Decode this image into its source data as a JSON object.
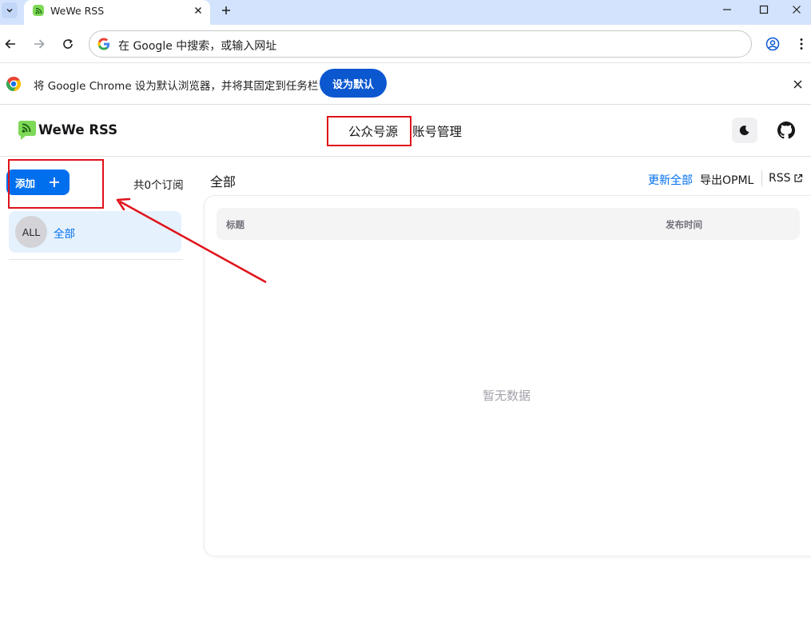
{
  "browser": {
    "tab_title": "WeWe RSS",
    "omnibox_placeholder": "在 Google 中搜索，或输入网址",
    "infobar_text": "将 Google Chrome 设为默认浏览器，并将其固定到任务栏",
    "infobar_button": "设为默认"
  },
  "app": {
    "brand": "WeWe RSS",
    "nav": {
      "active": "公众号源",
      "second": "账号管理"
    },
    "sidebar": {
      "add_label": "添加",
      "subscription_count": "共0个订阅",
      "feeds": [
        {
          "avatar": "ALL",
          "label": "全部"
        }
      ]
    },
    "main": {
      "title": "全部",
      "actions": {
        "refresh_all": "更新全部",
        "export_opml": "导出OPML",
        "rss": "RSS"
      },
      "table": {
        "columns": [
          "标题",
          "发布时间"
        ],
        "empty_text": "暂无数据"
      }
    }
  },
  "colors": {
    "primary": "#006fee",
    "annotation_red": "#e0121a",
    "chrome_blue": "#0b57d0"
  }
}
